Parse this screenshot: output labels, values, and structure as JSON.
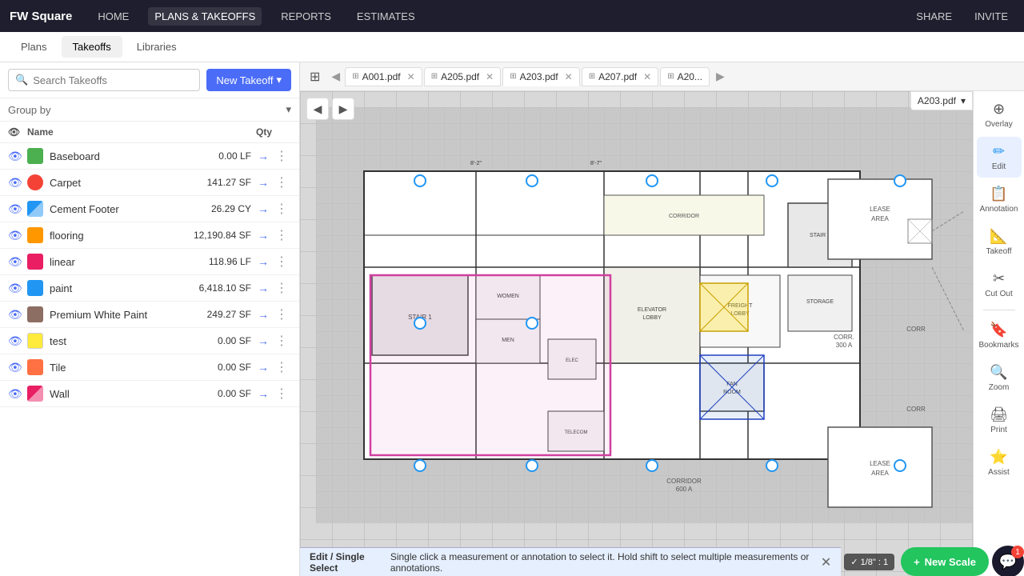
{
  "app": {
    "brand": "FW Square",
    "nav": [
      "HOME",
      "PLANS & TAKEOFFS",
      "REPORTS",
      "ESTIMATES"
    ],
    "active_nav": "PLANS & TAKEOFFS",
    "top_right": [
      "SHARE",
      "INVITE"
    ]
  },
  "sub_nav": {
    "tabs": [
      "Plans",
      "Takeoffs",
      "Libraries"
    ],
    "active": "Takeoffs"
  },
  "left_panel": {
    "search_placeholder": "Search Takeoffs",
    "new_takeoff_label": "New Takeoff",
    "group_by_label": "Group by",
    "table": {
      "col_name": "Name",
      "col_qty": "Qty",
      "rows": [
        {
          "name": "Baseboard",
          "qty": "0.00 LF",
          "icon_class": "icon-baseboard"
        },
        {
          "name": "Carpet",
          "qty": "141.27 SF",
          "icon_class": "icon-carpet"
        },
        {
          "name": "Cement Footer",
          "qty": "26.29 CY",
          "icon_class": "icon-cement"
        },
        {
          "name": "flooring",
          "qty": "12,190.84 SF",
          "icon_class": "icon-flooring"
        },
        {
          "name": "linear",
          "qty": "118.96 LF",
          "icon_class": "icon-linear"
        },
        {
          "name": "paint",
          "qty": "6,418.10 SF",
          "icon_class": "icon-paint"
        },
        {
          "name": "Premium White Paint",
          "qty": "249.27 SF",
          "icon_class": "icon-premium"
        },
        {
          "name": "test",
          "qty": "0.00 SF",
          "icon_class": "icon-test"
        },
        {
          "name": "Tile",
          "qty": "0.00 SF",
          "icon_class": "icon-tile"
        },
        {
          "name": "Wall",
          "qty": "0.00 SF",
          "icon_class": "icon-wall"
        }
      ]
    }
  },
  "tabs": {
    "items": [
      "A001.pdf",
      "A205.pdf",
      "A203.pdf",
      "A207.pdf",
      "A20..."
    ],
    "active": "A203.pdf"
  },
  "plan_title": "A203.pdf",
  "tools": [
    {
      "name": "overlay",
      "label": "Overlay",
      "icon": "⊕"
    },
    {
      "name": "edit",
      "label": "Edit",
      "icon": "✏️",
      "active": true
    },
    {
      "name": "annotation",
      "label": "Annotation",
      "icon": "📝"
    },
    {
      "name": "takeoff",
      "label": "Takeoff",
      "icon": "📐"
    },
    {
      "name": "cut-out",
      "label": "Cut Out",
      "icon": "✂️"
    },
    {
      "name": "bookmarks",
      "label": "Bookmarks",
      "icon": "🔖"
    },
    {
      "name": "zoom",
      "label": "Zoom",
      "icon": "🔍"
    },
    {
      "name": "print",
      "label": "Print",
      "icon": "🖨️"
    },
    {
      "name": "assist",
      "label": "Assist",
      "icon": "🤖"
    }
  ],
  "status_bar": {
    "bold_text": "Edit / Single Select",
    "message": "Single click a measurement or annotation to select it. Hold shift to select multiple measurements or annotations.",
    "scale_label": "1/8\" : 1",
    "new_scale_label": "New Scale"
  },
  "chat": {
    "badge": "1"
  }
}
